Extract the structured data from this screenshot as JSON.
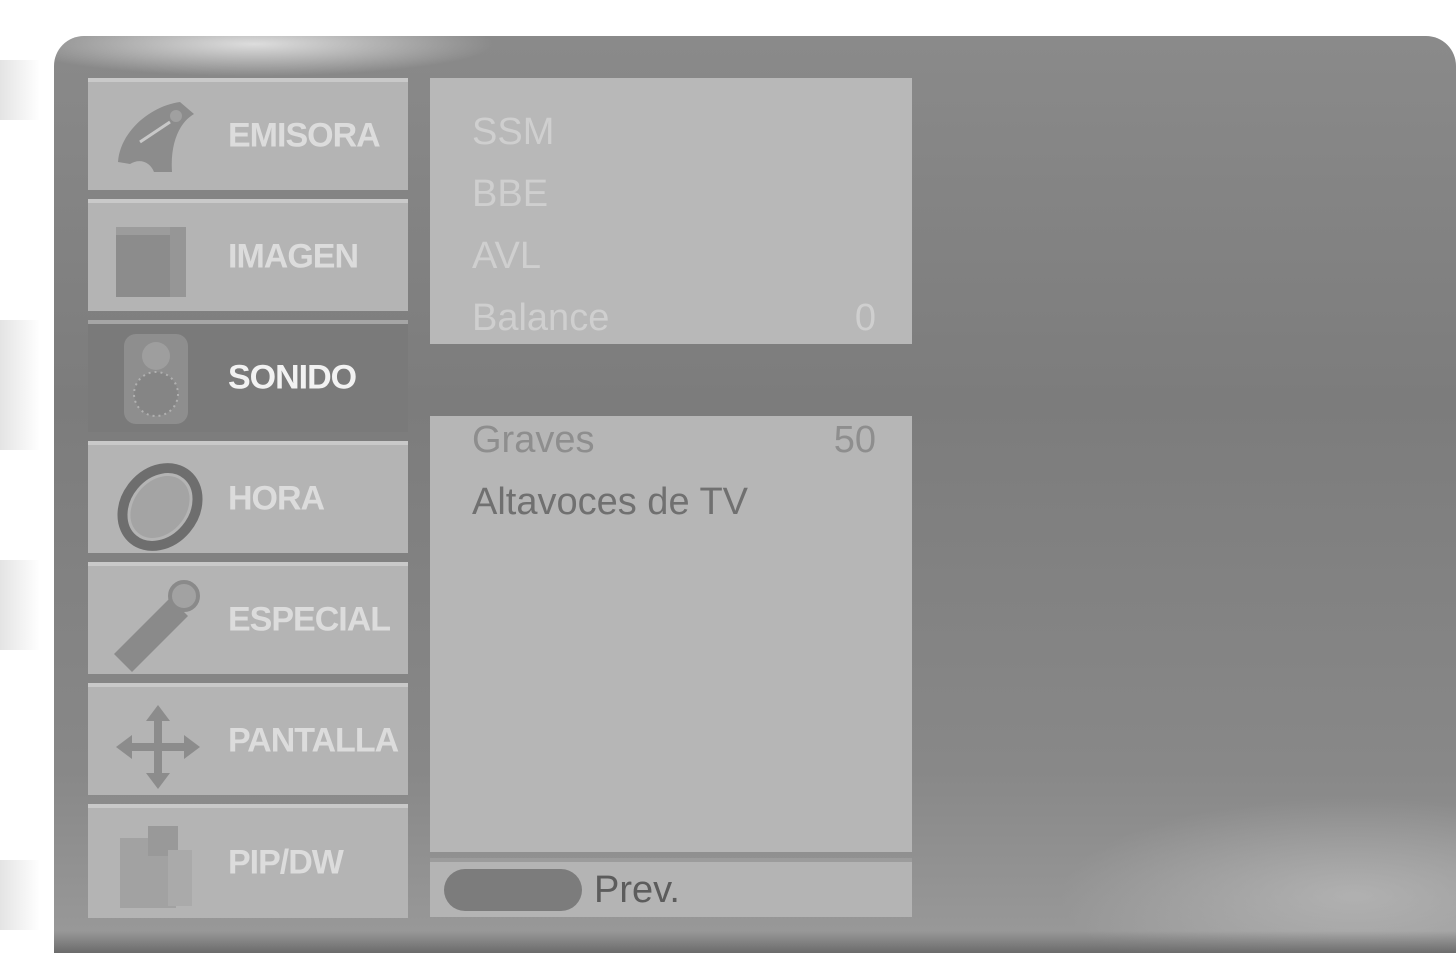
{
  "menu": {
    "items": [
      {
        "label": "EMISORA",
        "icon": "antenna-icon",
        "selected": false
      },
      {
        "label": "IMAGEN",
        "icon": "picture-icon",
        "selected": false
      },
      {
        "label": "SONIDO",
        "icon": "speaker-icon",
        "selected": true
      },
      {
        "label": "HORA",
        "icon": "clock-icon",
        "selected": false
      },
      {
        "label": "ESPECIAL",
        "icon": "key-icon",
        "selected": false
      },
      {
        "label": "PANTALLA",
        "icon": "move-arrows-icon",
        "selected": false
      },
      {
        "label": "PIP/DW",
        "icon": "pip-icon",
        "selected": false
      }
    ]
  },
  "submenu": {
    "rows": [
      {
        "label": "SSM",
        "value": ""
      },
      {
        "label": "BBE",
        "value": ""
      },
      {
        "label": "AVL",
        "value": ""
      },
      {
        "label": "Balance",
        "value": "0"
      },
      {
        "label": "Graves",
        "value": "50"
      },
      {
        "label": "Altavoces de TV",
        "value": ""
      }
    ]
  },
  "footer": {
    "prev_label": "Prev."
  },
  "colors": {
    "panel": "#b8b8b8",
    "selected": "#7a7a7a",
    "background": "#808080"
  }
}
